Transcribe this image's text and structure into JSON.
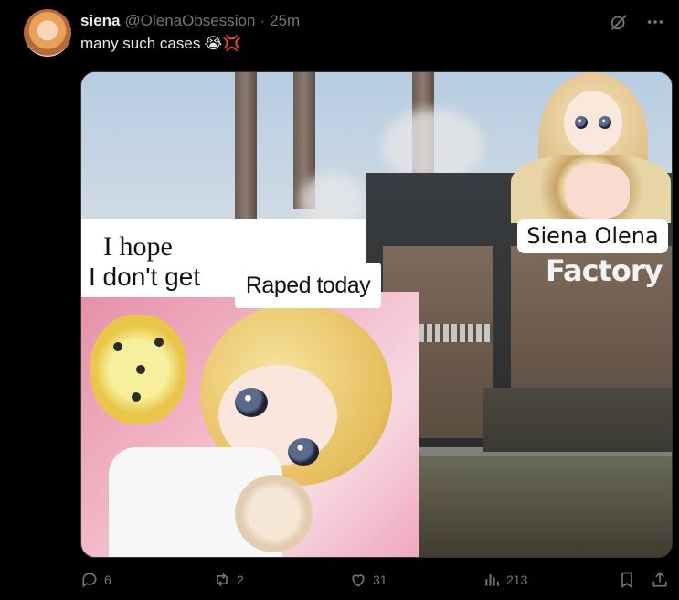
{
  "author": {
    "name": "siena",
    "handle": "@OlenaObsession",
    "separator": "·",
    "time": "25m"
  },
  "tweet": {
    "text": "many such cases",
    "emojis": "😭💢"
  },
  "media": {
    "caption_hope_line1": "I hope",
    "caption_hope_line2": "I don't get",
    "caption_raped": "Raped today",
    "label_siena": "Siena Olena",
    "label_factory": "Factory"
  },
  "actions": {
    "replies": "6",
    "retweets": "2",
    "likes": "31",
    "views": "213"
  },
  "icons": {
    "grok": "grok-icon",
    "more": "more-icon",
    "reply": "reply-icon",
    "retweet": "retweet-icon",
    "like": "heart-icon",
    "views": "views-icon",
    "bookmark": "bookmark-icon",
    "share": "share-icon"
  },
  "colors": {
    "background": "#000000",
    "text": "#e7e9ea",
    "muted": "#71767b"
  }
}
